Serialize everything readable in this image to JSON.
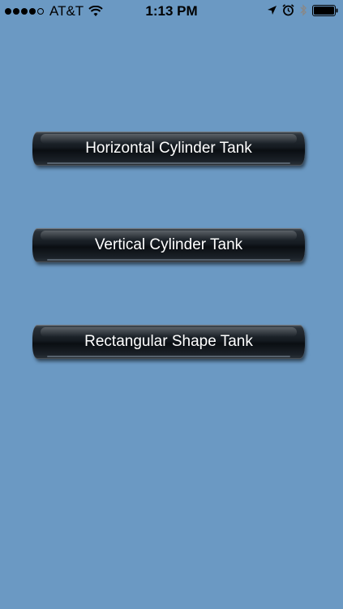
{
  "status_bar": {
    "carrier": "AT&T",
    "time": "1:13 PM",
    "signal_bars_filled": 4,
    "signal_bars_total": 5
  },
  "buttons": [
    {
      "label": "Horizontal Cylinder Tank"
    },
    {
      "label": "Vertical Cylinder Tank"
    },
    {
      "label": "Rectangular Shape Tank"
    }
  ],
  "colors": {
    "background": "#6b99c3",
    "button_face": "#151b21",
    "button_text": "#ffffff"
  }
}
